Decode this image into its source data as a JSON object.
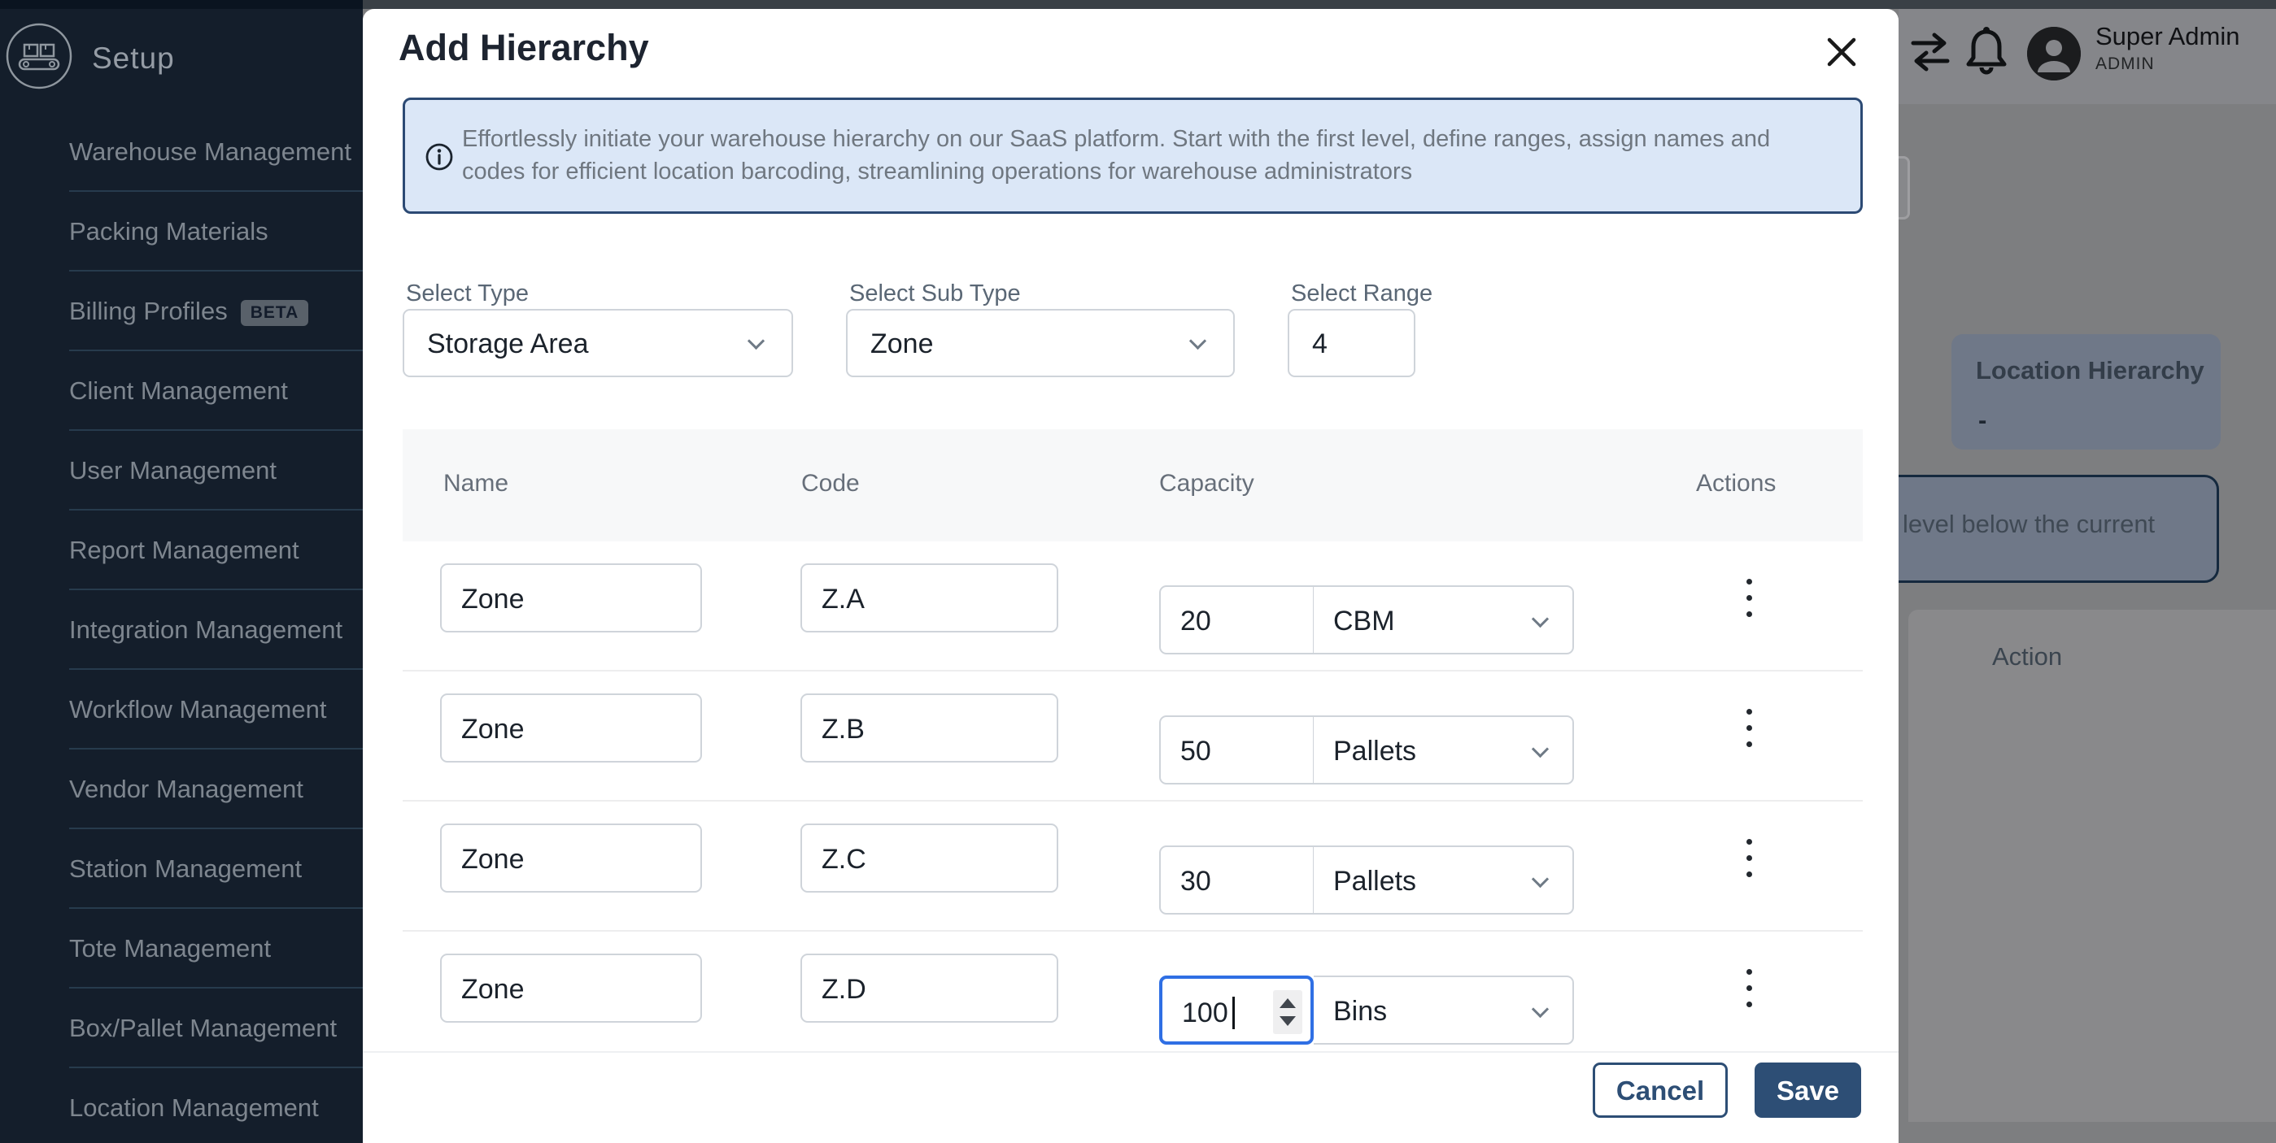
{
  "app": {
    "topbar": {
      "user_name": "Super Admin",
      "user_role": "ADMIN",
      "icons": [
        "transfer-arrows-icon",
        "notification-bell-icon",
        "user-avatar-icon"
      ]
    },
    "sidebar": {
      "title": "Setup",
      "logo": "conveyor-belt-icon",
      "items": [
        {
          "label": "Warehouse Management"
        },
        {
          "label": "Packing Materials"
        },
        {
          "label": "Billing Profiles",
          "badge": "BETA"
        },
        {
          "label": "Client Management"
        },
        {
          "label": "User Management"
        },
        {
          "label": "Report Management"
        },
        {
          "label": "Integration Management"
        },
        {
          "label": "Workflow Management"
        },
        {
          "label": "Vendor Management"
        },
        {
          "label": "Station Management"
        },
        {
          "label": "Tote Management"
        },
        {
          "label": "Box/Pallet Management"
        },
        {
          "label": "Location Management"
        }
      ]
    },
    "background_page": {
      "panel_title": "Location Hierarchy",
      "panel_value": "-",
      "clipped_text": "level below the current",
      "action_label": "Action"
    }
  },
  "modal": {
    "title": "Add Hierarchy",
    "info_text": "Effortlessly initiate your warehouse hierarchy on our SaaS platform. Start with the first level, define ranges, assign names and codes for efficient location barcoding, streamlining operations for warehouse administrators",
    "fields": {
      "type": {
        "label": "Select Type",
        "value": "Storage Area"
      },
      "sub_type": {
        "label": "Select Sub Type",
        "value": "Zone"
      },
      "range": {
        "label": "Select Range",
        "value": "4"
      }
    },
    "table": {
      "headers": [
        "Name",
        "Code",
        "Capacity",
        "Actions"
      ],
      "rows": [
        {
          "name": "Zone",
          "code": "Z.A",
          "capacity": "20",
          "unit": "CBM",
          "focused": false
        },
        {
          "name": "Zone",
          "code": "Z.B",
          "capacity": "50",
          "unit": "Pallets",
          "focused": false
        },
        {
          "name": "Zone",
          "code": "Z.C",
          "capacity": "30",
          "unit": "Pallets",
          "focused": false
        },
        {
          "name": "Zone",
          "code": "Z.D",
          "capacity": "100",
          "unit": "Bins",
          "focused": true
        }
      ]
    },
    "buttons": {
      "cancel": "Cancel",
      "save": "Save"
    }
  },
  "colors": {
    "sidebar_bg": "#141e2b",
    "modal_bg": "#ffffff",
    "info_banner_bg": "#dbe7f7",
    "info_banner_border": "#2c4a74",
    "primary_button": "#2d4e75",
    "focus_border": "#2f6fe4",
    "overlay_content_bg": "#7d7e80"
  }
}
